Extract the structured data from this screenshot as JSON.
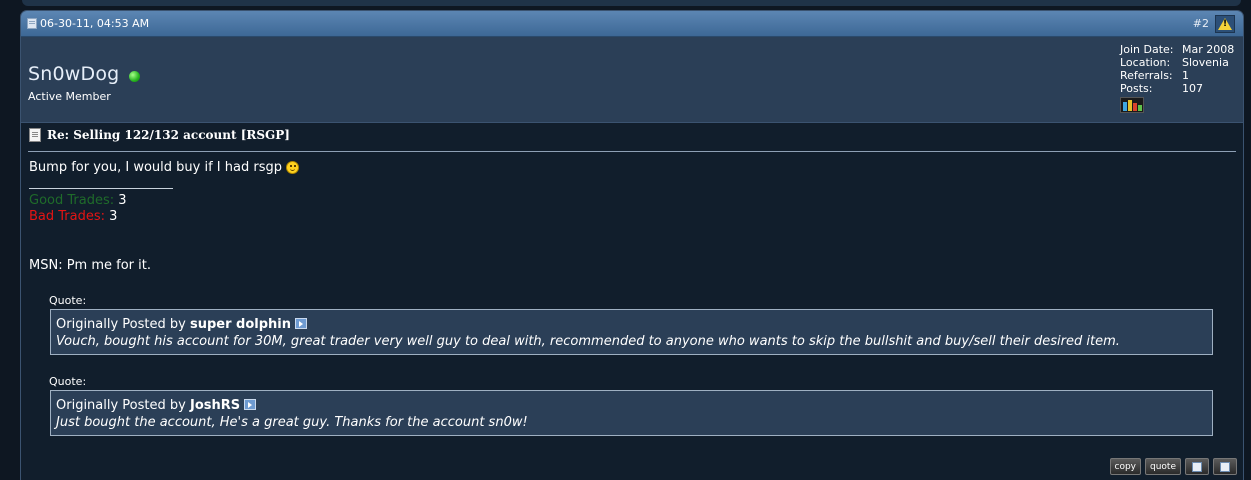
{
  "post": {
    "date": "06-30-11, 04:53 AM",
    "number": "#2",
    "author": {
      "name": "Sn0wDog",
      "title": "Active Member",
      "stats": [
        {
          "label": "Join Date:",
          "value": "Mar 2008"
        },
        {
          "label": "Location:",
          "value": "Slovenia"
        },
        {
          "label": "Referrals:",
          "value": "1"
        },
        {
          "label": "Posts:",
          "value": "107"
        }
      ]
    },
    "title": "Re: Selling 122/132 account [RSGP]",
    "message": "Bump for you, I would buy if I had rsgp",
    "signature": {
      "good_label": "Good Trades:",
      "good_value": "3",
      "bad_label": "Bad Trades:",
      "bad_value": "3",
      "msn": "MSN: Pm me for it."
    },
    "quotes": [
      {
        "label": "Quote:",
        "prefix": "Originally Posted by",
        "author": "super dolphin",
        "text": "Vouch, bought his account for 30M, great trader very well guy to deal with, recommended to anyone who wants to skip the bullshit and buy/sell their desired item."
      },
      {
        "label": "Quote:",
        "prefix": "Originally Posted by",
        "author": "JoshRS",
        "text": "Just bought the account, He's a great guy. Thanks for the account sn0w!"
      }
    ],
    "controls": {
      "copy": "copy",
      "quote": "quote"
    }
  },
  "icons": {
    "post": "post-icon",
    "report": "warning-icon",
    "online": "online-status-icon",
    "badge": "achievement-icon",
    "doc": "document-icon",
    "smiley": "smiley-icon",
    "view_post": "view-post-icon",
    "multiquote": "multiquote-icon",
    "edit": "edit-icon"
  },
  "colors": {
    "header": "#4b76a3",
    "panel": "#2b3f57",
    "body": "#111e2c",
    "good": "#1f6b2a",
    "bad": "#e61414",
    "online": "#25b31e"
  }
}
